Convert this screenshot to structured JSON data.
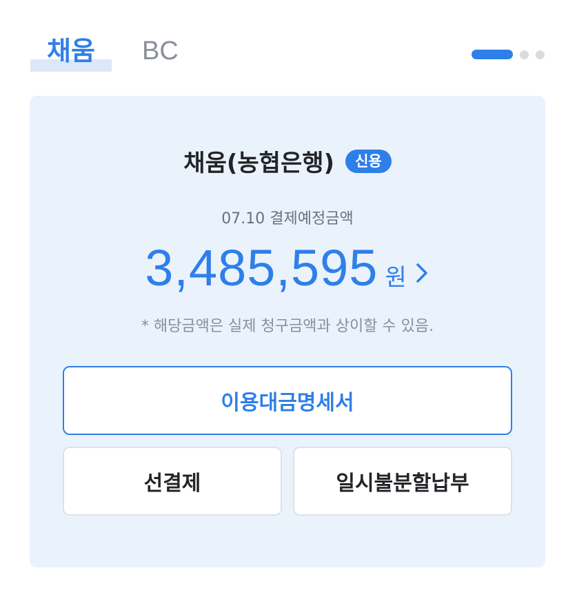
{
  "tabs": [
    {
      "label": "채움",
      "active": true
    },
    {
      "label": "BC",
      "active": false
    }
  ],
  "pager": {
    "total": 3,
    "current": 1
  },
  "card": {
    "title": "채움(농협은행)",
    "badge": "신용",
    "due_label": "07.10 결제예정금액",
    "amount": "3,485,595",
    "unit": "원",
    "notice": "* 해당금액은 실제 청구금액과 상이할 수 있음."
  },
  "buttons": {
    "statement": "이용대금명세서",
    "prepay": "선결제",
    "installment": "일시불분할납부"
  },
  "colors": {
    "accent": "#2f7fe8",
    "card_bg": "#eaf2fc"
  }
}
